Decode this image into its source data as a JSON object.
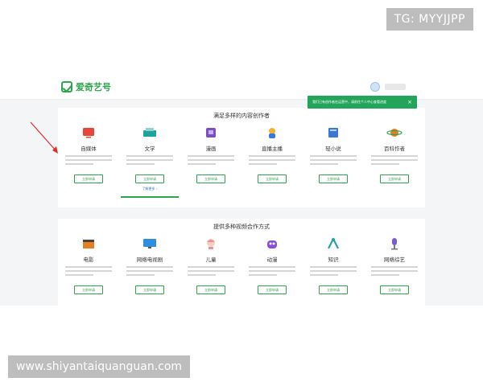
{
  "watermarks": {
    "tg": "TG: MYYJJPP",
    "site": "www.shiyantaiquanguan.com"
  },
  "header": {
    "logo_text": "爱奇艺号"
  },
  "toast": {
    "text": "我们已有创作者在运营中，请前往个人中心查看进度",
    "close": "×"
  },
  "creators": {
    "title": "满足多样的内容创作者",
    "items": [
      {
        "label": "自媒体",
        "icon": "tv-icon",
        "color": "#e8453c",
        "apply": "立即申请"
      },
      {
        "label": "文学",
        "icon": "typewriter-icon",
        "color": "#1fa3a0",
        "apply": "立即申请",
        "more": "了解更多 ›"
      },
      {
        "label": "漫画",
        "icon": "comic-icon",
        "color": "#7b4cc9",
        "apply": "立即申请"
      },
      {
        "label": "直播主播",
        "icon": "streamer-icon",
        "color": "#f2b233",
        "apply": "立即申请"
      },
      {
        "label": "轻小说",
        "icon": "book-icon",
        "color": "#3a78d8",
        "apply": "立即申请"
      },
      {
        "label": "百科作者",
        "icon": "planet-icon",
        "color": "#e67e22",
        "apply": "立即申请"
      }
    ]
  },
  "partners": {
    "title": "提供多种视频合作方式",
    "items": [
      {
        "label": "电影",
        "icon": "clapperboard-icon",
        "color": "#e67e22",
        "apply": "立即申请"
      },
      {
        "label": "网络电视剧",
        "icon": "monitor-icon",
        "color": "#2e8ee0",
        "apply": "立即申请"
      },
      {
        "label": "儿童",
        "icon": "child-icon",
        "color": "#f08aa5",
        "apply": "立即申请"
      },
      {
        "label": "动漫",
        "icon": "monster-icon",
        "color": "#8a4fd8",
        "apply": "立即申请"
      },
      {
        "label": "知识",
        "icon": "compass-icon",
        "color": "#1fa3a0",
        "apply": "立即申请"
      },
      {
        "label": "网络综艺",
        "icon": "microphone-icon",
        "color": "#7a5bd6",
        "apply": "立即申请"
      }
    ]
  }
}
